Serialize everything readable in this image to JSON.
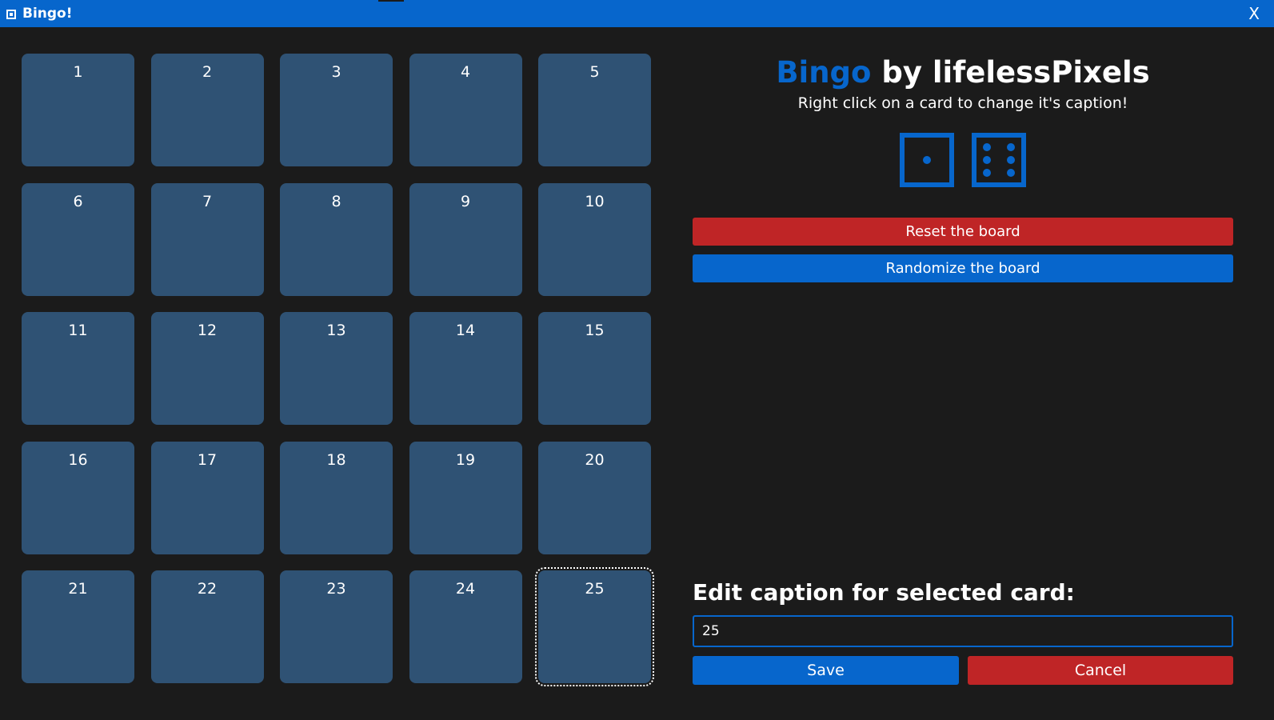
{
  "window": {
    "title": "Bingo!",
    "close_label": "X"
  },
  "board": {
    "cards": [
      "1",
      "2",
      "3",
      "4",
      "5",
      "6",
      "7",
      "8",
      "9",
      "10",
      "11",
      "12",
      "13",
      "14",
      "15",
      "16",
      "17",
      "18",
      "19",
      "20",
      "21",
      "22",
      "23",
      "24",
      "25"
    ],
    "selected_index": 24
  },
  "header": {
    "title_accent": "Bingo",
    "title_rest": " by lifelessPixels",
    "subtitle": "Right click on a card to change it's caption!"
  },
  "icons": {
    "die_one": "dice-one-icon",
    "die_six": "dice-six-icon"
  },
  "actions": {
    "reset_label": "Reset the board",
    "randomize_label": "Randomize the board"
  },
  "editor": {
    "label": "Edit caption for selected card:",
    "value": "25",
    "save_label": "Save",
    "cancel_label": "Cancel"
  },
  "colors": {
    "accent_blue": "#0766cc",
    "danger_red": "#bf2526",
    "card_bg": "#2f5274",
    "window_bg": "#1b1b1b"
  }
}
